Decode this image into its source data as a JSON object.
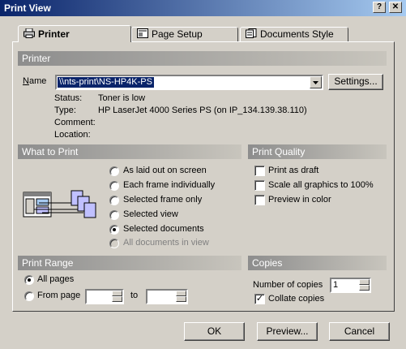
{
  "window": {
    "title": "Print View",
    "help_label": "?",
    "close_label": "✕"
  },
  "tabs": [
    {
      "label": "Printer",
      "icon": "printer-icon"
    },
    {
      "label": "Page Setup",
      "icon": "page-setup-icon"
    },
    {
      "label": "Documents Style",
      "icon": "documents-style-icon"
    }
  ],
  "printer": {
    "section_title": "Printer",
    "name_label": "Name",
    "name_value": "\\\\nts-print\\NS-HP4K-PS",
    "settings_button": "Settings...",
    "status_label": "Status:",
    "status_value": "Toner is low",
    "type_label": "Type:",
    "type_value": "HP LaserJet 4000 Series PS (on IP_134.139.38.110)",
    "comment_label": "Comment:",
    "comment_value": "",
    "location_label": "Location:",
    "location_value": ""
  },
  "what_to_print": {
    "section_title": "What to Print",
    "options": [
      {
        "label": "As laid out on screen",
        "selected": false,
        "enabled": true
      },
      {
        "label": "Each frame individually",
        "selected": false,
        "enabled": true
      },
      {
        "label": "Selected frame only",
        "selected": false,
        "enabled": true
      },
      {
        "label": "Selected view",
        "selected": false,
        "enabled": true
      },
      {
        "label": "Selected documents",
        "selected": true,
        "enabled": true
      },
      {
        "label": "All documents in view",
        "selected": false,
        "enabled": false
      }
    ]
  },
  "print_quality": {
    "section_title": "Print Quality",
    "options": [
      {
        "label": "Print as draft",
        "checked": false
      },
      {
        "label": "Scale all graphics to 100%",
        "checked": false
      },
      {
        "label": "Preview in color",
        "checked": false
      }
    ]
  },
  "print_range": {
    "section_title": "Print Range",
    "all_pages_label": "All pages",
    "all_pages_selected": true,
    "from_page_label": "From page",
    "from_page_value": "",
    "to_label": "to",
    "to_value": ""
  },
  "copies": {
    "section_title": "Copies",
    "number_label": "Number of copies",
    "number_value": "1",
    "collate_label": "Collate copies",
    "collate_checked": true
  },
  "footer": {
    "ok": "OK",
    "preview": "Preview...",
    "cancel": "Cancel"
  },
  "colors": {
    "titlebar_start": "#0a246a",
    "titlebar_end": "#a6caf0",
    "dialog_bg": "#d4d0c8",
    "section_start": "#8d8d8d"
  }
}
